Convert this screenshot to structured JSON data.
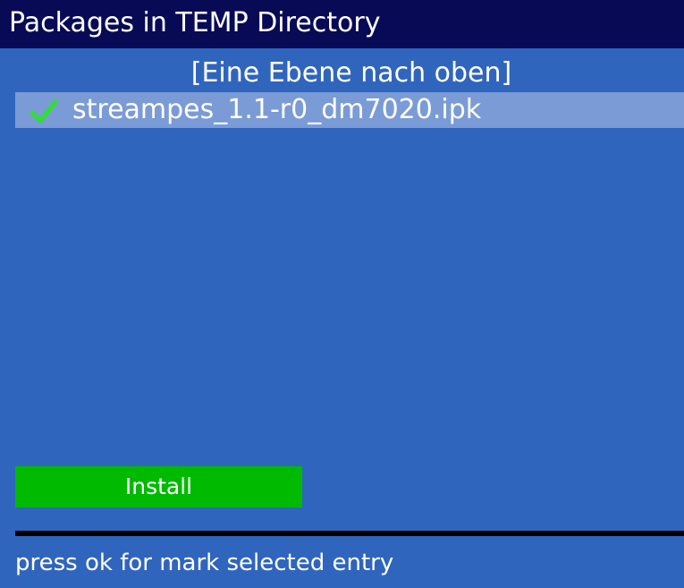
{
  "window": {
    "title": "Packages in TEMP Directory"
  },
  "file_list": {
    "parent_entry": "[Eine Ebene nach oben]",
    "items": [
      {
        "name": "streampes_1.1-r0_dm7020.ipk",
        "marked": true,
        "icon": "checkmark-icon"
      }
    ]
  },
  "actions": {
    "install_label": "Install"
  },
  "status": {
    "hint": "press ok for mark selected entry"
  },
  "colors": {
    "background": "#3065bd",
    "title_bar": "#080a56",
    "selected_row": "#7b9bd6",
    "install_button": "#00ba00",
    "check_mark": "#2ee02e",
    "text": "#ffffff"
  }
}
